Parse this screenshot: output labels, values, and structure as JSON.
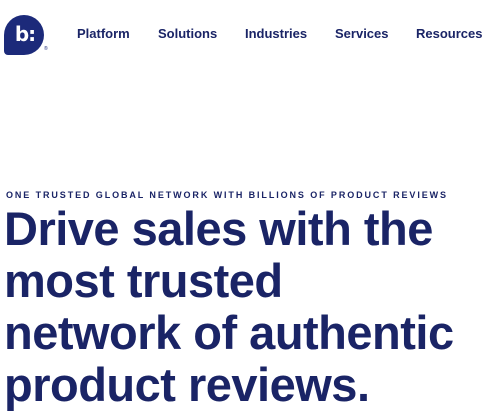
{
  "logo": {
    "text": "b:",
    "registered": "®"
  },
  "nav": {
    "items": [
      "Platform",
      "Solutions",
      "Industries",
      "Services",
      "Resources"
    ]
  },
  "hero": {
    "eyebrow": "ONE TRUSTED GLOBAL NETWORK WITH BILLIONS OF PRODUCT REVIEWS",
    "headline_lines": [
      "Drive sales with the",
      "most trusted",
      "network of authentic",
      "product reviews."
    ]
  },
  "colors": {
    "brand": "#1c2a7a",
    "text": "#1a2466",
    "background": "#ffffff"
  }
}
